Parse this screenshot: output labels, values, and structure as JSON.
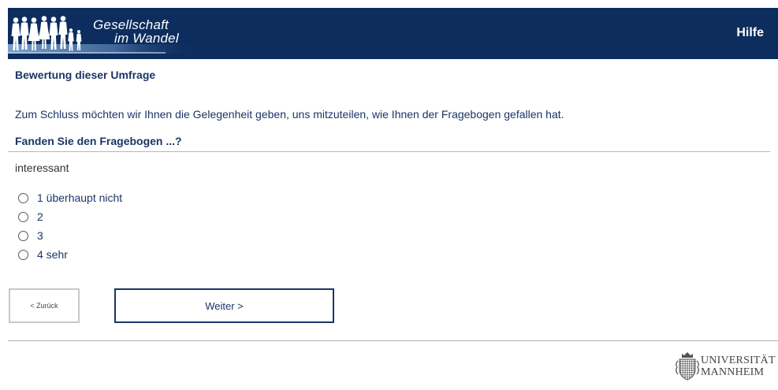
{
  "header": {
    "logo_line1": "Gesellschaft",
    "logo_line2": "im Wandel",
    "help_label": "Hilfe"
  },
  "survey": {
    "title": "Bewertung dieser Umfrage",
    "intro": "Zum Schluss möchten wir Ihnen die Gelegenheit geben, uns mitzuteilen, wie Ihnen der Fragebogen gefallen hat.",
    "question": "Fanden Sie den Fragebogen ...?",
    "item_label": "interessant",
    "options": [
      {
        "label": "1 überhaupt nicht",
        "selected": false
      },
      {
        "label": "2",
        "selected": false
      },
      {
        "label": "3",
        "selected": false
      },
      {
        "label": "4 sehr",
        "selected": false
      }
    ]
  },
  "navigation": {
    "back_label": "< Zurück",
    "next_label": "Weiter >"
  },
  "footer": {
    "university_line1": "UNIVERSITÄT",
    "university_line2": "MANNHEIM",
    "logo_icon": "university-shield-icon"
  },
  "colors": {
    "header_background": "#0c2d5e",
    "text_primary": "#1b3566",
    "button_border_primary": "#1b3566",
    "button_border_secondary": "#c8c8c8"
  }
}
